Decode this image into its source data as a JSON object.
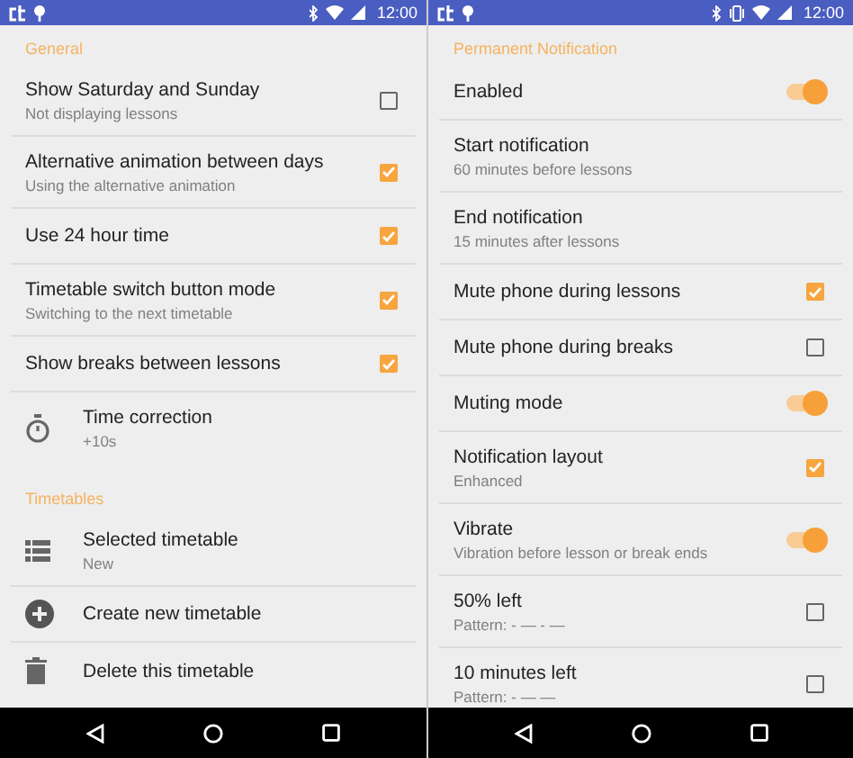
{
  "screens": [
    {
      "status_bar": {
        "time": "12:00",
        "vibrate": false
      },
      "sections": [
        {
          "title": "General",
          "items": [
            {
              "kind": "checkbox",
              "title": "Show Saturday and Sunday",
              "subtitle": "Not displaying lessons",
              "checked": false
            },
            {
              "kind": "checkbox",
              "title": "Alternative animation between days",
              "subtitle": "Using the alternative animation",
              "checked": true
            },
            {
              "kind": "checkbox",
              "title": "Use 24 hour time",
              "checked": true
            },
            {
              "kind": "checkbox",
              "title": "Timetable switch button mode",
              "subtitle": "Switching to the next timetable",
              "checked": true
            },
            {
              "kind": "checkbox",
              "title": "Show breaks between lessons",
              "checked": true
            },
            {
              "kind": "timer",
              "title": "Time correction",
              "subtitle": "+10s"
            }
          ]
        },
        {
          "title": "Timetables",
          "items": [
            {
              "kind": "list",
              "title": "Selected timetable",
              "subtitle": "New"
            },
            {
              "kind": "add",
              "title": "Create new timetable"
            },
            {
              "kind": "delete",
              "title": "Delete this timetable"
            }
          ]
        }
      ]
    },
    {
      "status_bar": {
        "time": "12:00",
        "vibrate": true
      },
      "sections": [
        {
          "title": "Permanent Notification",
          "items": [
            {
              "kind": "switch",
              "title": "Enabled",
              "on": true
            },
            {
              "kind": "plain",
              "title": "Start notification",
              "subtitle": "60 minutes before lessons"
            },
            {
              "kind": "plain",
              "title": "End notification",
              "subtitle": "15 minutes after lessons"
            },
            {
              "kind": "checkbox",
              "title": "Mute phone during lessons",
              "checked": true
            },
            {
              "kind": "checkbox",
              "title": "Mute phone during breaks",
              "checked": false
            },
            {
              "kind": "switch",
              "title": "Muting mode",
              "on": true
            },
            {
              "kind": "checkbox",
              "title": "Notification layout",
              "subtitle": "Enhanced",
              "checked": true
            },
            {
              "kind": "switch",
              "title": "Vibrate",
              "subtitle": "Vibration before lesson or break ends",
              "on": true
            },
            {
              "kind": "checkbox",
              "title": "50% left",
              "subtitle": "Pattern: - — - —",
              "checked": false
            },
            {
              "kind": "checkbox",
              "title": "10 minutes left",
              "subtitle": "Pattern: - — —",
              "checked": false
            }
          ]
        }
      ]
    }
  ]
}
